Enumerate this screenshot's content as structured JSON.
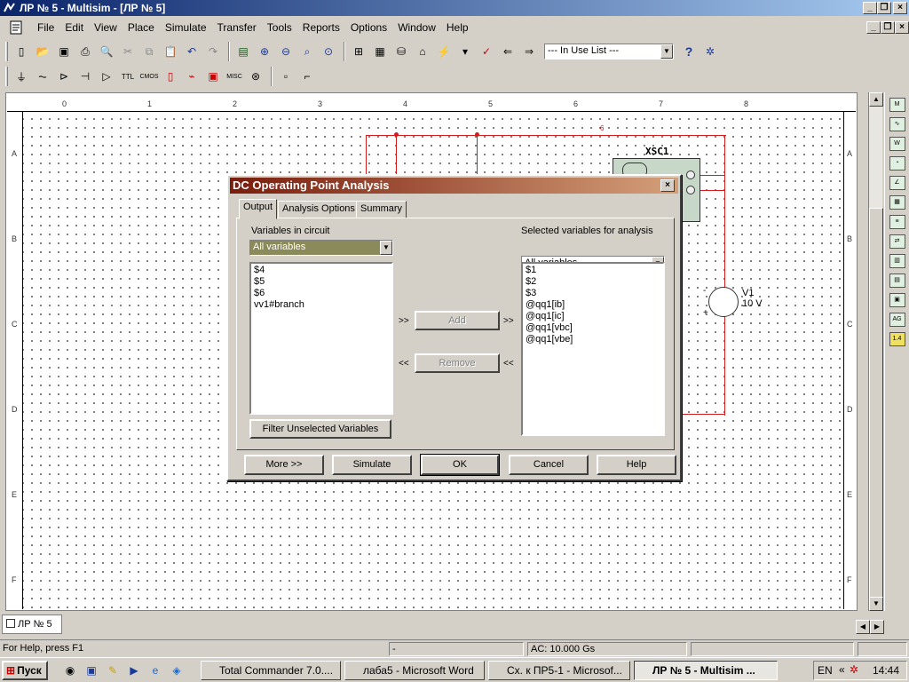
{
  "window": {
    "title": "ЛР № 5 - Multisim - [ЛР № 5]"
  },
  "menu": [
    "File",
    "Edit",
    "View",
    "Place",
    "Simulate",
    "Transfer",
    "Tools",
    "Reports",
    "Options",
    "Window",
    "Help"
  ],
  "toolbar": {
    "in_use_list": "--- In Use List ---"
  },
  "ruler": {
    "columns": [
      "0",
      "1",
      "2",
      "3",
      "4",
      "5",
      "6",
      "7",
      "8"
    ],
    "rows": [
      "A",
      "B",
      "C",
      "D",
      "E",
      "F"
    ]
  },
  "schematic": {
    "scope_label": "XSC1",
    "source_name": "V1",
    "source_value": "10 V",
    "net_label": "6",
    "source_minus": "-",
    "source_plus": "+"
  },
  "dialog": {
    "title": "DC Operating Point Analysis",
    "tabs": [
      "Output",
      "Analysis Options",
      "Summary"
    ],
    "active_tab": "Output",
    "left_label": "Variables in circuit",
    "left_filter": "All variables",
    "left_items": [
      "$4",
      "$5",
      "$6",
      "vv1#branch"
    ],
    "right_label": "Selected variables for analysis",
    "right_filter": "All variables",
    "right_items": [
      "$1",
      "$2",
      "$3",
      "@qq1[ib]",
      "@qq1[ic]",
      "@qq1[vbc]",
      "@qq1[vbe]"
    ],
    "add_label": "Add",
    "remove_label": "Remove",
    "add_left_arrows": ">>",
    "add_right_arrows": ">>",
    "remove_left_arrows": "<<",
    "remove_right_arrows": "<<",
    "filter_button": "Filter Unselected Variables",
    "buttons": {
      "more": "More >>",
      "simulate": "Simulate",
      "ok": "OK",
      "cancel": "Cancel",
      "help": "Help"
    }
  },
  "doc_tab": "ЛР № 5",
  "status": {
    "help_text": "For Help, press F1",
    "middle": "-",
    "ac": "AC: 10.000 Gs"
  },
  "taskbar": {
    "start": "Пуск",
    "tasks": [
      "Total Commander 7.0....",
      "лаба5 - Microsoft Word",
      "Сх. к ПР5-1 - Microsof...",
      "ЛР № 5 - Multisim ..."
    ],
    "lang": "EN",
    "clock": "14:44"
  },
  "colors": {
    "wire": "#d41c1c",
    "title_bar": "#0a246a",
    "dialog_title": "#7a1d0c"
  }
}
